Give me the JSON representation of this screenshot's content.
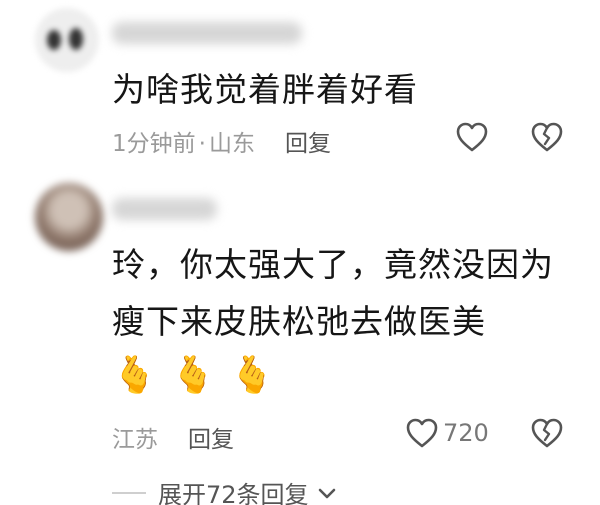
{
  "comments": [
    {
      "text": "为啥我觉着胖着好看",
      "time": "1分钟前",
      "separator": "·",
      "location": "山东",
      "reply_label": "回复"
    },
    {
      "text": "玲，你太强大了，竟然没因为瘦下来皮肤松弛去做医美",
      "emojis": [
        "🫰",
        "🫰",
        "🫰"
      ],
      "location": "江苏",
      "reply_label": "回复",
      "like_count": "720",
      "expand_label": "展开72条回复"
    }
  ],
  "icons": {
    "like": "heart-outline-icon",
    "dislike": "broken-heart-icon",
    "expand": "chevron-down-icon"
  }
}
